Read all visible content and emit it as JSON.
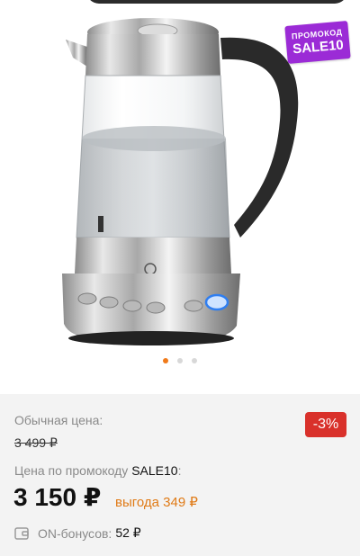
{
  "promo_sticker": {
    "line1": "ПРОМОКОД",
    "line2": "SALE10"
  },
  "gallery": {
    "slides": 3,
    "active_index": 0
  },
  "pricing": {
    "regular_label": "Обычная цена:",
    "old_price": "3 499 ₽",
    "discount_badge": "-3%",
    "promo_label": "Цена по промокоду",
    "promo_code": "SALE10",
    "promo_colon": ":",
    "current_price": "3 150 ₽",
    "savings": "выгода 349 ₽"
  },
  "bonus": {
    "label": "ON-бонусов",
    "separator": " :",
    "value": "52 ₽"
  },
  "colors": {
    "accent_orange": "#e07b17",
    "discount_red": "#d9312b",
    "promo_purple": "#9b2bd6",
    "kettle_handle": "#2a2a2a"
  }
}
